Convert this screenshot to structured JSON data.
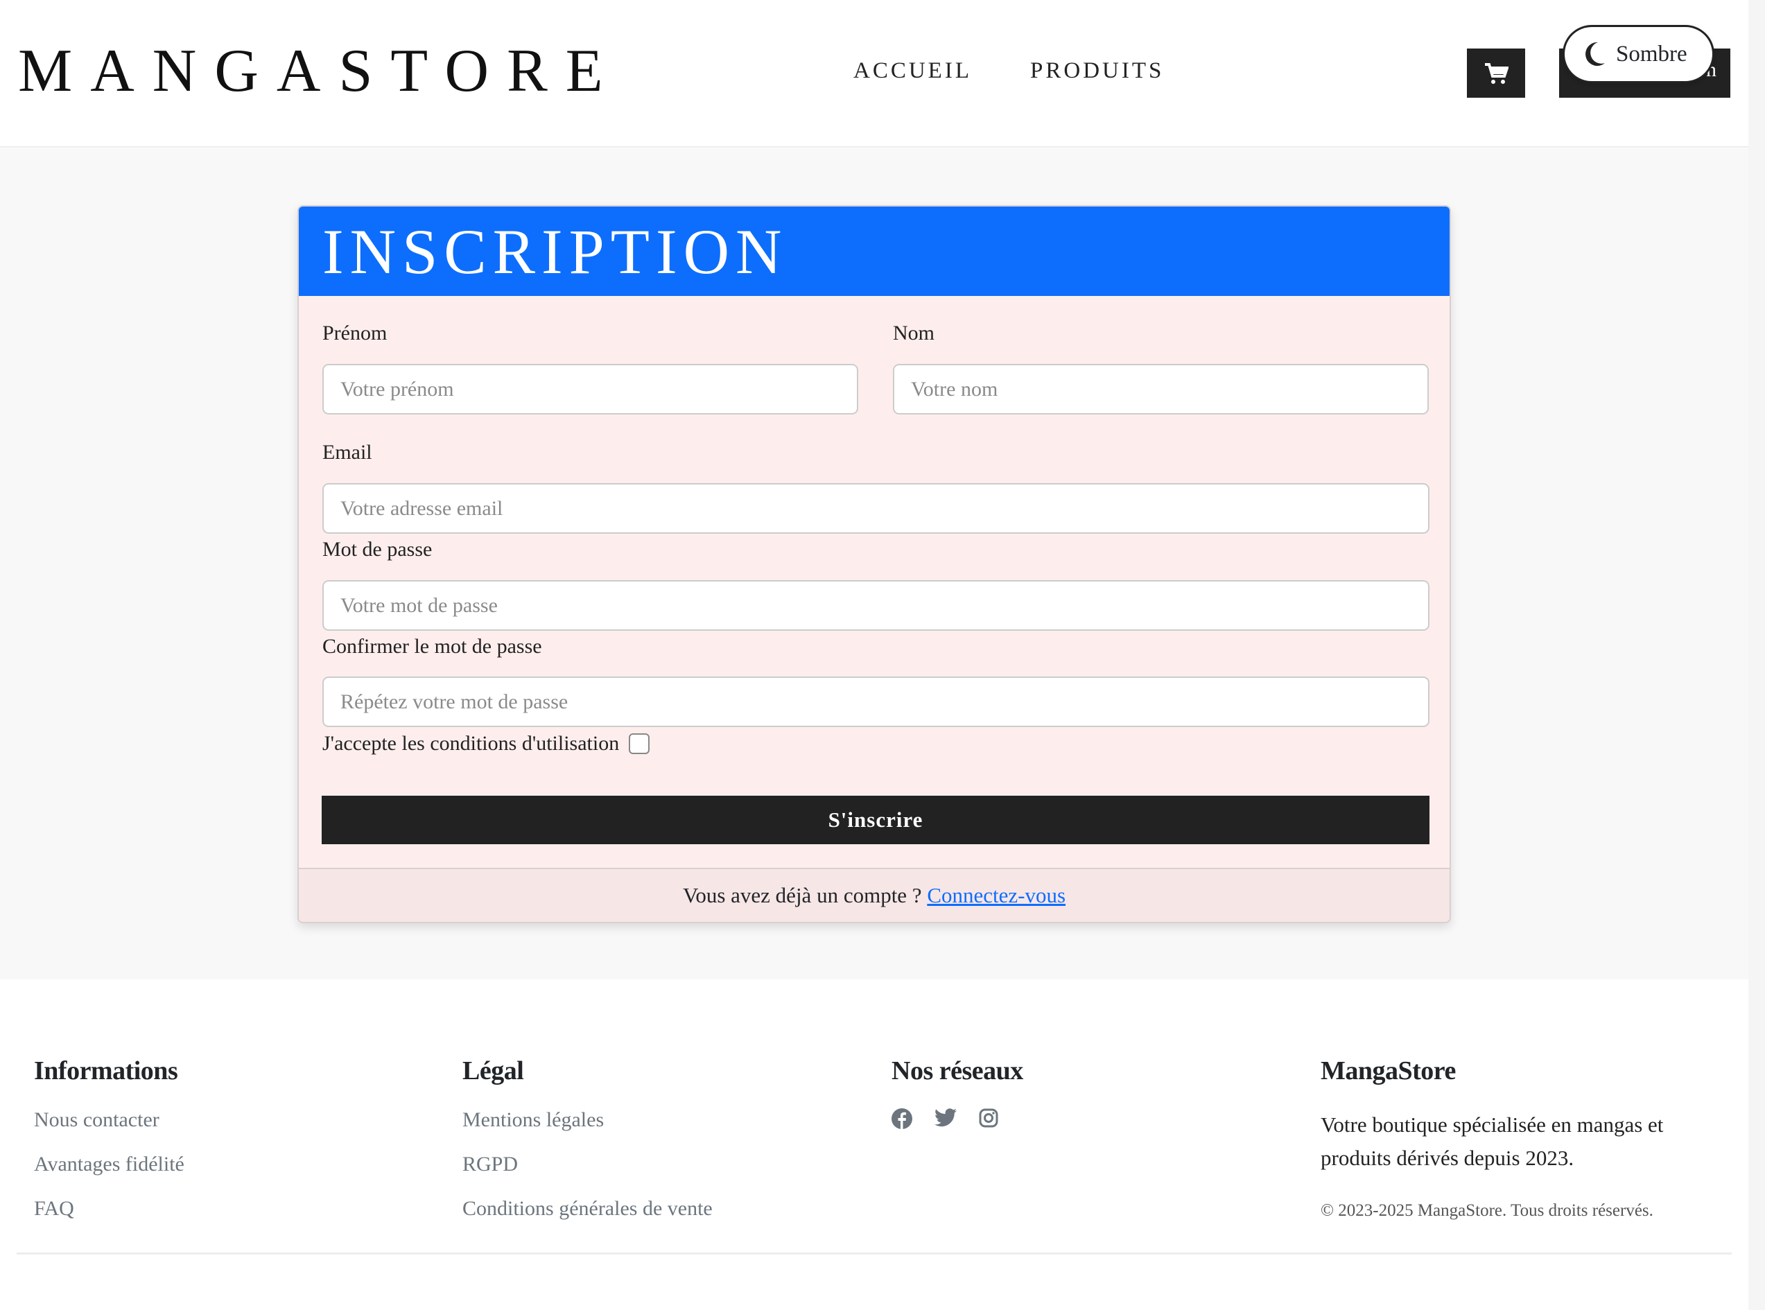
{
  "header": {
    "logo": "MANGASTORE",
    "nav": [
      "ACCUEIL",
      "PRODUITS"
    ],
    "account_button_partial": "n",
    "theme_toggle": "Sombre"
  },
  "form": {
    "title": "INSCRIPTION",
    "first_name": {
      "label": "Prénom",
      "placeholder": "Votre prénom"
    },
    "last_name": {
      "label": "Nom",
      "placeholder": "Votre nom"
    },
    "email": {
      "label": "Email",
      "placeholder": "Votre adresse email"
    },
    "password": {
      "label": "Mot de passe",
      "placeholder": "Votre mot de passe"
    },
    "confirm": {
      "label": "Confirmer le mot de passe",
      "placeholder": "Répétez votre mot de passe"
    },
    "terms": "J'accepte les conditions d'utilisation",
    "submit": "S'inscrire",
    "login_prompt": "Vous avez déjà un compte ?",
    "login_link": "Connectez-vous"
  },
  "footer": {
    "info": {
      "title": "Informations",
      "links": [
        "Nous contacter",
        "Avantages fidélité",
        "FAQ"
      ]
    },
    "legal": {
      "title": "Légal",
      "links": [
        "Mentions légales",
        "RGPD",
        "Conditions générales de vente"
      ]
    },
    "social": {
      "title": "Nos réseaux",
      "icons": [
        "facebook-icon",
        "twitter-icon",
        "instagram-icon"
      ]
    },
    "about": {
      "title": "MangaStore",
      "text": "Votre boutique spécialisée en mangas et produits dérivés depuis 2023.",
      "copyright": "© 2023-2025 MangaStore. Tous droits réservés."
    }
  },
  "colors": {
    "primary": "#0d6efd",
    "dark": "#222222",
    "form_bg": "#fdeeed"
  }
}
